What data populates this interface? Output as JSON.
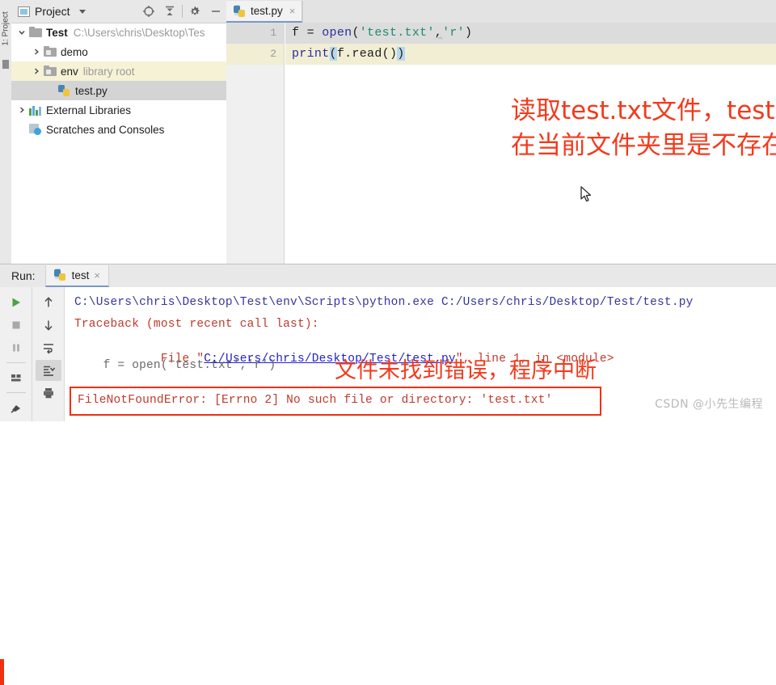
{
  "project_panel": {
    "vertical_label": "1: Project",
    "title": "Project",
    "toolbar_icons": [
      "locate-icon",
      "collapse-all-icon",
      "settings-gear-icon",
      "minimize-icon"
    ],
    "tree": [
      {
        "label": "Test",
        "sub": "C:\\Users\\chris\\Desktop\\Tes",
        "icon": "folder-icon",
        "expanded": true,
        "indent": 0,
        "state": "normal"
      },
      {
        "label": "demo",
        "sub": "",
        "icon": "source-folder-icon",
        "expanded": false,
        "indent": 1,
        "state": "normal"
      },
      {
        "label": "env",
        "sub": "library root",
        "icon": "source-folder-icon",
        "expanded": false,
        "indent": 1,
        "state": "highlighted"
      },
      {
        "label": "test.py",
        "sub": "",
        "icon": "python-file-icon",
        "expanded": null,
        "indent": 2,
        "state": "selected"
      },
      {
        "label": "External Libraries",
        "sub": "",
        "icon": "library-icon",
        "expanded": false,
        "indent": 0,
        "state": "normal"
      },
      {
        "label": "Scratches and Consoles",
        "sub": "",
        "icon": "scratches-icon",
        "expanded": null,
        "indent": 0,
        "state": "normal"
      }
    ]
  },
  "editor": {
    "tab": {
      "label": "test.py",
      "icon": "python-file-icon",
      "close": "×"
    },
    "lines": [
      {
        "number": "1",
        "text": "f = open('test.txt','r')"
      },
      {
        "number": "2",
        "text": "print(f.read())"
      }
    ],
    "code_tokens": {
      "l1_a": "f = ",
      "l1_fn": "open",
      "l1_p1": "(",
      "l1_str1": "'test.txt'",
      "l1_comma": ",",
      "l1_str2": "'r'",
      "l1_p2": ")",
      "l2_fn": "print",
      "l2_p1": "(",
      "l2_body": "f.read()",
      "l2_p2": ")"
    },
    "annotation": "读取test.txt文件，test.txt文件\n在当前文件夹里是不存在的。",
    "annotation_color": "#f33a1c"
  },
  "run_panel": {
    "label": "Run:",
    "tab": {
      "label": "test",
      "icon": "python-file-icon",
      "close": "×"
    },
    "left_toolbar": [
      "run-icon",
      "stop-icon",
      "pause-icon",
      "rerun-layout-icon",
      "pin-icon"
    ],
    "right_toolbar": [
      "up-arrow-icon",
      "down-arrow-icon",
      "soft-wrap-icon",
      "scroll-to-end-icon",
      "print-icon"
    ],
    "console": {
      "line1": "C:\\Users\\chris\\Desktop\\Test\\env\\Scripts\\python.exe C:/Users/chris/Desktop/Test/test.py",
      "line2": "Traceback (most recent call last):",
      "line3_pre": "  File \"",
      "line3_link": "C:/Users/chris/Desktop/Test/test.py",
      "line3_post": "\", line 1, in <module>",
      "line4": "    f = open('test.txt','r')",
      "error": "FileNotFoundError: [Errno 2] No such file or directory: 'test.txt'"
    },
    "annotation": "文件未找到错误，程序中断",
    "annotation_color": "#f33a1c",
    "error_box_color": "#f22f10"
  },
  "watermark": "CSDN @小先生编程"
}
